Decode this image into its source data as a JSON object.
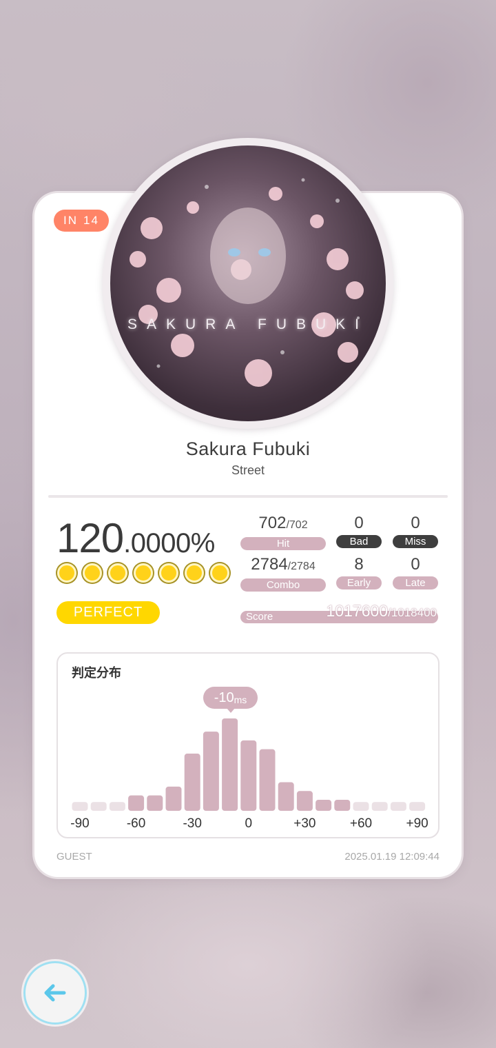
{
  "song": {
    "level_badge": {
      "difficulty": "IN",
      "level": "14",
      "color": "#ff8467"
    },
    "cover_text": "SAKURA FUBUKI",
    "title": "Sakura Fubuki",
    "subtitle": "Street"
  },
  "accuracy": {
    "integer": "120",
    "decimal": ".0000%"
  },
  "grade": {
    "label": "PERFECT",
    "dots": 7,
    "color": "#ffd700"
  },
  "stats": {
    "hit": {
      "value": "702",
      "total": "/702",
      "label": "Hit"
    },
    "bad": {
      "value": "0",
      "label": "Bad"
    },
    "miss": {
      "value": "0",
      "label": "Miss"
    },
    "combo": {
      "value": "2784",
      "total": "/2784",
      "label": "Combo"
    },
    "early": {
      "value": "8",
      "label": "Early"
    },
    "late": {
      "value": "0",
      "label": "Late"
    },
    "score": {
      "label": "Score",
      "value": "1017600",
      "max": "/1018400"
    }
  },
  "distribution": {
    "title": "判定分布",
    "peak_value": "-10",
    "peak_unit": "ms",
    "x_ticks": [
      "-90",
      "-60",
      "-30",
      "0",
      "+30",
      "+60",
      "+90"
    ],
    "chart_data": {
      "type": "bar",
      "x": [
        -90,
        -80,
        -70,
        -60,
        -50,
        -40,
        -30,
        -20,
        -10,
        0,
        10,
        20,
        30,
        40,
        50,
        60,
        70,
        80,
        90
      ],
      "values": [
        4,
        4,
        4,
        7,
        7,
        11,
        26,
        36,
        42,
        32,
        28,
        13,
        9,
        5,
        5,
        4,
        4,
        4,
        4
      ],
      "xlabel": "",
      "ylabel": "",
      "colors": {
        "bar": "#d3b1bd",
        "faint": "#ebe1e5"
      }
    }
  },
  "footer": {
    "player": "GUEST",
    "datetime": "2025.01.19 12:09:44"
  },
  "nav": {
    "back_icon": "arrow-left-icon",
    "accent": "#5bc7ea"
  }
}
